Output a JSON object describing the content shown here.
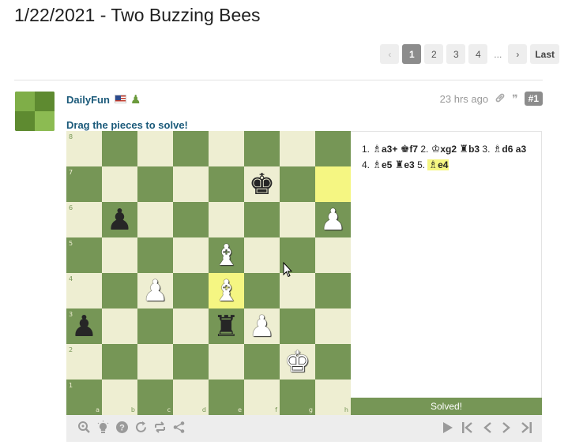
{
  "page": {
    "title": "1/22/2021 - Two Buzzing Bees"
  },
  "pagination": {
    "prev_icon": "‹",
    "pages": [
      "1",
      "2",
      "3",
      "4"
    ],
    "current": "1",
    "ellipsis": "...",
    "next_icon": "›",
    "last_label": "Last"
  },
  "post": {
    "username": "DailyFun",
    "flag": "us-flag",
    "user_icon": "♟",
    "time": "23 hrs ago",
    "link_icon": "🔗",
    "quote_icon": "❞",
    "post_number": "#1",
    "instruction": "Drag the pieces to solve!"
  },
  "board": {
    "ranks": [
      "8",
      "7",
      "6",
      "5",
      "4",
      "3",
      "2",
      "1"
    ],
    "files": [
      "a",
      "b",
      "c",
      "d",
      "e",
      "f",
      "g",
      "h"
    ],
    "highlight_squares": [
      "h7",
      "e4"
    ],
    "pieces": [
      {
        "square": "f7",
        "glyph": "♚",
        "color": "black"
      },
      {
        "square": "b6",
        "glyph": "♟",
        "color": "black"
      },
      {
        "square": "h6",
        "glyph": "♟",
        "color": "white"
      },
      {
        "square": "e5",
        "glyph": "♝",
        "color": "white"
      },
      {
        "square": "c4",
        "glyph": "♟",
        "color": "white"
      },
      {
        "square": "e4",
        "glyph": "♝",
        "color": "white"
      },
      {
        "square": "a3",
        "glyph": "♟",
        "color": "black"
      },
      {
        "square": "e3",
        "glyph": "♜",
        "color": "black"
      },
      {
        "square": "f3",
        "glyph": "♟",
        "color": "white"
      },
      {
        "square": "g2",
        "glyph": "♚",
        "color": "white"
      }
    ],
    "light_color": "#eeeed2",
    "dark_color": "#769656",
    "highlight_color": "#f5f682"
  },
  "moves": {
    "items": [
      {
        "num": "1.",
        "fig": "♗",
        "text": "a3+"
      },
      {
        "fig": "♚",
        "text": "f7"
      },
      {
        "num": "2.",
        "fig": "♔",
        "text": "xg2"
      },
      {
        "fig": "♜",
        "text": "b3"
      },
      {
        "num": "3.",
        "fig": "♗",
        "text": "d6"
      },
      {
        "fig": "",
        "text": "a3"
      },
      {
        "num": "4.",
        "fig": "♗",
        "text": "e5"
      },
      {
        "fig": "♜",
        "text": "e3"
      },
      {
        "num": "5.",
        "fig": "♗",
        "text": "e4",
        "current": true
      }
    ],
    "status": "Solved!"
  },
  "toolbar": {
    "left_icons": [
      "analysis-icon",
      "hint-icon",
      "help-icon",
      "reset-icon",
      "flip-board-icon",
      "share-icon"
    ],
    "right_icons": [
      "play-icon",
      "first-move-icon",
      "previous-move-icon",
      "next-move-icon",
      "last-move-icon"
    ]
  }
}
